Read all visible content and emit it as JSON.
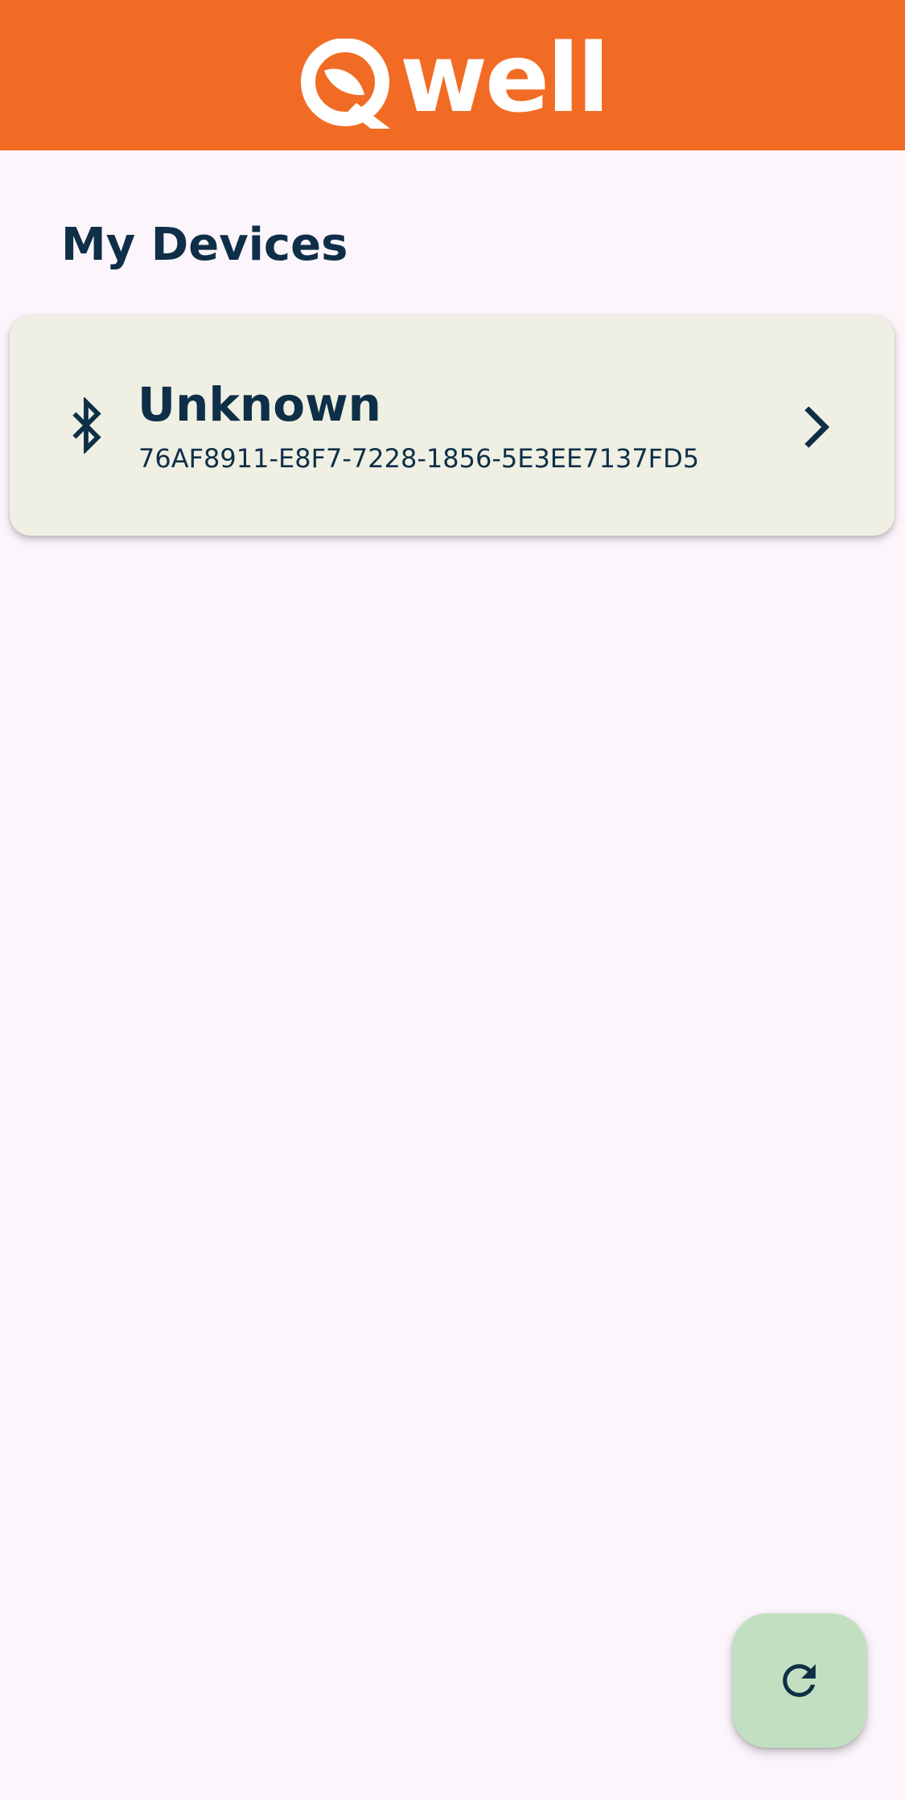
{
  "app_bar": {
    "logo_text": "Qwell",
    "logo_wordmark": "well",
    "background_color": "#f26b24",
    "logo_icon": "qwell-logo-icon"
  },
  "main": {
    "title": "My Devices",
    "devices": [
      {
        "name": "Unknown",
        "id": "76AF8911-E8F7-7228-1856-5E3EE7137FD5",
        "icon": "bluetooth-icon",
        "trailing_icon": "chevron-right-icon"
      }
    ]
  },
  "fab": {
    "icon": "refresh-icon",
    "background_color": "#c2e0c1"
  },
  "colors": {
    "text_primary": "#0f2f48",
    "card_background": "#eff0e3",
    "page_background": "#fcf5fc"
  }
}
